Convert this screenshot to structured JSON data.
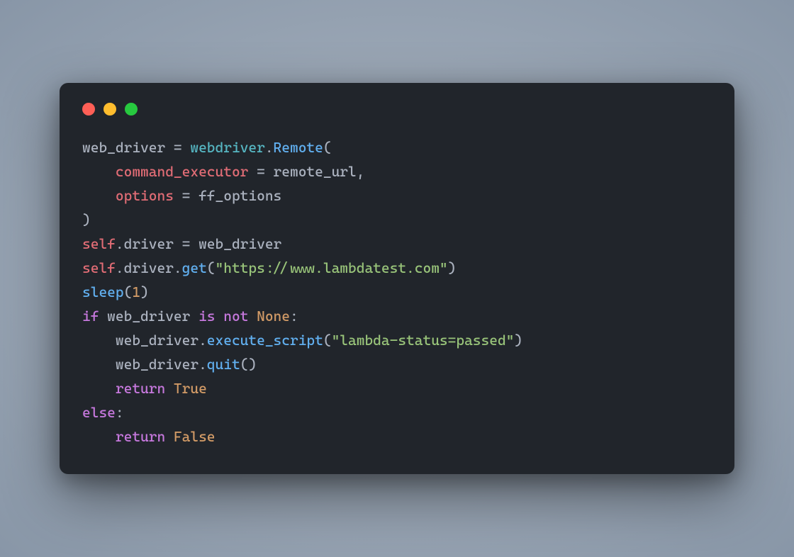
{
  "window": {
    "dots": [
      "red",
      "yellow",
      "green"
    ]
  },
  "code": {
    "lines": [
      [
        {
          "t": "web_driver",
          "c": "tk-var"
        },
        {
          "t": " ",
          "c": "tk-op"
        },
        {
          "t": "=",
          "c": "tk-op"
        },
        {
          "t": " ",
          "c": "tk-op"
        },
        {
          "t": "webdriver",
          "c": "tk-obj"
        },
        {
          "t": ".",
          "c": "tk-punc"
        },
        {
          "t": "Remote",
          "c": "tk-call"
        },
        {
          "t": "(",
          "c": "tk-punc"
        }
      ],
      [
        {
          "t": "    ",
          "c": "tk-op"
        },
        {
          "t": "command_executor",
          "c": "tk-prop"
        },
        {
          "t": " ",
          "c": "tk-op"
        },
        {
          "t": "=",
          "c": "tk-op"
        },
        {
          "t": " ",
          "c": "tk-op"
        },
        {
          "t": "remote_url",
          "c": "tk-var"
        },
        {
          "t": ",",
          "c": "tk-punc"
        }
      ],
      [
        {
          "t": "    ",
          "c": "tk-op"
        },
        {
          "t": "options",
          "c": "tk-prop"
        },
        {
          "t": " ",
          "c": "tk-op"
        },
        {
          "t": "=",
          "c": "tk-op"
        },
        {
          "t": " ",
          "c": "tk-op"
        },
        {
          "t": "ff_options",
          "c": "tk-var"
        }
      ],
      [
        {
          "t": ")",
          "c": "tk-punc"
        }
      ],
      [
        {
          "t": "self",
          "c": "tk-self"
        },
        {
          "t": ".",
          "c": "tk-punc"
        },
        {
          "t": "driver",
          "c": "tk-var"
        },
        {
          "t": " ",
          "c": "tk-op"
        },
        {
          "t": "=",
          "c": "tk-op"
        },
        {
          "t": " ",
          "c": "tk-op"
        },
        {
          "t": "web_driver",
          "c": "tk-var"
        }
      ],
      [
        {
          "t": "self",
          "c": "tk-self"
        },
        {
          "t": ".",
          "c": "tk-punc"
        },
        {
          "t": "driver",
          "c": "tk-var"
        },
        {
          "t": ".",
          "c": "tk-punc"
        },
        {
          "t": "get",
          "c": "tk-call"
        },
        {
          "t": "(",
          "c": "tk-punc"
        },
        {
          "t": "\"https://www.lambdatest.com\"",
          "c": "tk-str"
        },
        {
          "t": ")",
          "c": "tk-punc"
        }
      ],
      [
        {
          "t": "sleep",
          "c": "tk-call"
        },
        {
          "t": "(",
          "c": "tk-punc"
        },
        {
          "t": "1",
          "c": "tk-num"
        },
        {
          "t": ")",
          "c": "tk-punc"
        }
      ],
      [
        {
          "t": "if",
          "c": "tk-kw"
        },
        {
          "t": " ",
          "c": "tk-op"
        },
        {
          "t": "web_driver",
          "c": "tk-var"
        },
        {
          "t": " ",
          "c": "tk-op"
        },
        {
          "t": "is",
          "c": "tk-kw"
        },
        {
          "t": " ",
          "c": "tk-op"
        },
        {
          "t": "not",
          "c": "tk-kw"
        },
        {
          "t": " ",
          "c": "tk-op"
        },
        {
          "t": "None",
          "c": "tk-const"
        },
        {
          "t": ":",
          "c": "tk-punc"
        }
      ],
      [
        {
          "t": "    ",
          "c": "tk-op"
        },
        {
          "t": "web_driver",
          "c": "tk-var"
        },
        {
          "t": ".",
          "c": "tk-punc"
        },
        {
          "t": "execute_script",
          "c": "tk-call"
        },
        {
          "t": "(",
          "c": "tk-punc"
        },
        {
          "t": "\"lambda-status=passed\"",
          "c": "tk-str"
        },
        {
          "t": ")",
          "c": "tk-punc"
        }
      ],
      [
        {
          "t": "    ",
          "c": "tk-op"
        },
        {
          "t": "web_driver",
          "c": "tk-var"
        },
        {
          "t": ".",
          "c": "tk-punc"
        },
        {
          "t": "quit",
          "c": "tk-call"
        },
        {
          "t": "()",
          "c": "tk-punc"
        }
      ],
      [
        {
          "t": "    ",
          "c": "tk-op"
        },
        {
          "t": "return",
          "c": "tk-kw"
        },
        {
          "t": " ",
          "c": "tk-op"
        },
        {
          "t": "True",
          "c": "tk-const"
        }
      ],
      [
        {
          "t": "else",
          "c": "tk-kw"
        },
        {
          "t": ":",
          "c": "tk-punc"
        }
      ],
      [
        {
          "t": "    ",
          "c": "tk-op"
        },
        {
          "t": "return",
          "c": "tk-kw"
        },
        {
          "t": " ",
          "c": "tk-op"
        },
        {
          "t": "False",
          "c": "tk-const"
        }
      ]
    ]
  }
}
